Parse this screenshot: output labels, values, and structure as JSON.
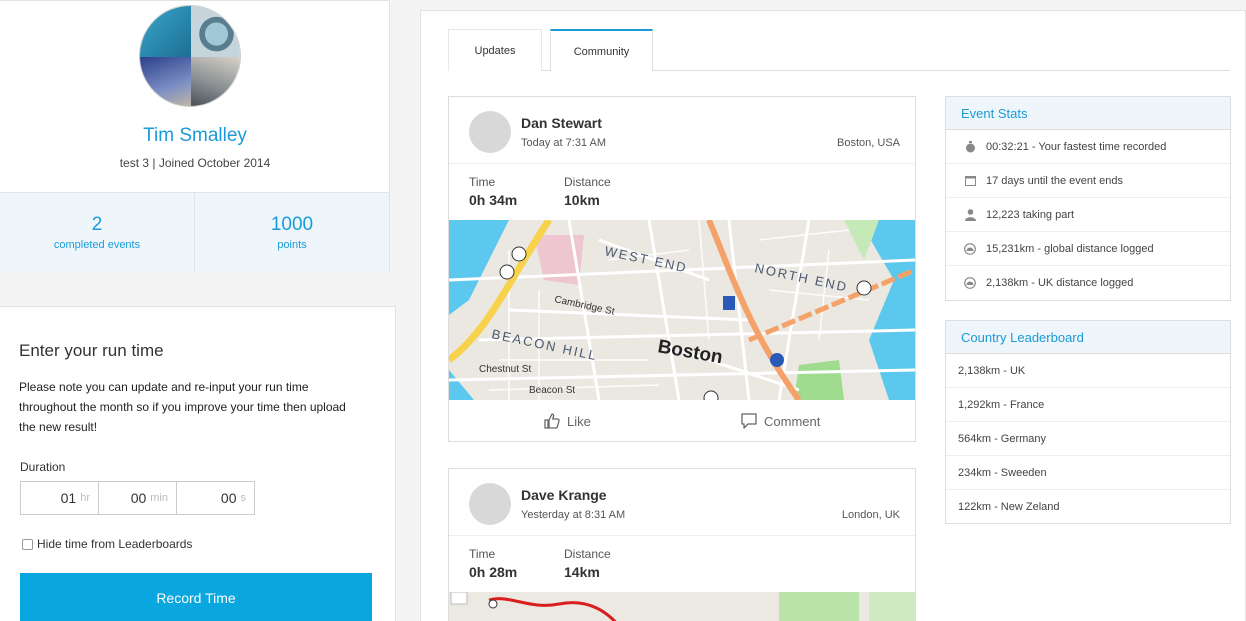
{
  "profile": {
    "name": "Tim Smalley",
    "meta": "test 3 | Joined October 2014",
    "stats": [
      {
        "value": "2",
        "label": "completed events"
      },
      {
        "value": "1000",
        "label": "points"
      }
    ]
  },
  "run_form": {
    "title": "Enter your run time",
    "note": "Please note you can update and re-input your run time throughout the month so if you improve your time then upload the new result!",
    "duration_label": "Duration",
    "hours": {
      "value": "01",
      "unit": "hr"
    },
    "minutes": {
      "value": "00",
      "unit": "min"
    },
    "seconds": {
      "value": "00",
      "unit": "s"
    },
    "hide_label": "Hide time from Leaderboards",
    "record_button": "Record Time"
  },
  "tabs": [
    {
      "label": "Updates",
      "active": false
    },
    {
      "label": "Community",
      "active": true
    }
  ],
  "posts": [
    {
      "name": "Dan Stewart",
      "time": "Today at 7:31 AM",
      "location": "Boston, USA",
      "time_label": "Time",
      "time_value": "0h 34m",
      "distance_label": "Distance",
      "distance_value": "10km",
      "map_labels": [
        "WEST END",
        "NORTH END",
        "BEACON HILL",
        "Boston",
        "Cambridge St",
        "Chestnut St",
        "Beacon St"
      ],
      "like_label": "Like",
      "comment_label": "Comment"
    },
    {
      "name": "Dave Krange",
      "time": "Yesterday at 8:31 AM",
      "location": "London, UK",
      "time_label": "Time",
      "time_value": "0h 28m",
      "distance_label": "Distance",
      "distance_value": "14km"
    }
  ],
  "event_stats": {
    "title": "Event Stats",
    "rows": [
      {
        "icon": "stopwatch-icon",
        "text": "00:32:21 - Your fastest time recorded"
      },
      {
        "icon": "calendar-icon",
        "text": "17 days until the event ends"
      },
      {
        "icon": "person-icon",
        "text": "12,223 taking part"
      },
      {
        "icon": "gauge-icon",
        "text": "15,231km - global distance logged"
      },
      {
        "icon": "gauge-icon",
        "text": "2,138km - UK distance logged"
      }
    ]
  },
  "leaderboard": {
    "title": "Country Leaderboard",
    "rows": [
      "2,138km - UK",
      "1,292km - France",
      "564km - Germany",
      "234km - Sweeden",
      "122km - New Zeland"
    ]
  },
  "colors": {
    "accent": "#1a9bd7",
    "button": "#0aa6df",
    "panel_header_bg": "#eef6fc"
  }
}
